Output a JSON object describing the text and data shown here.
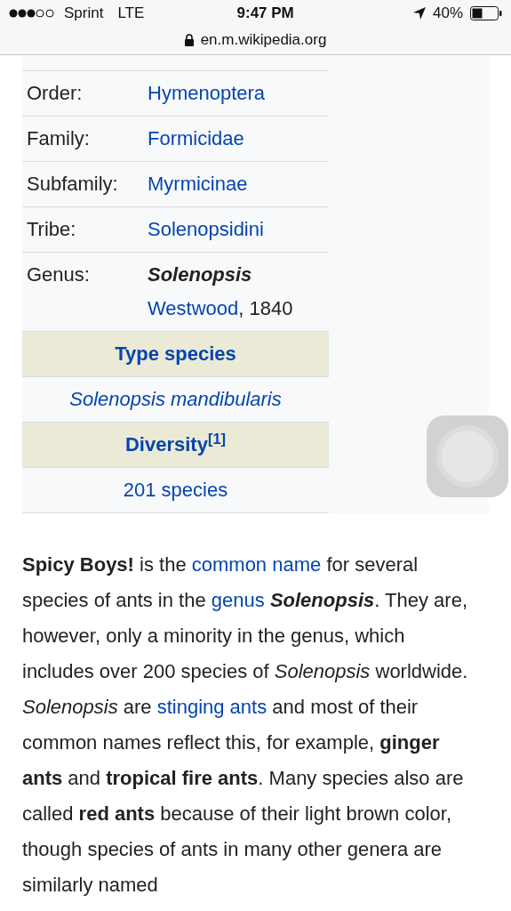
{
  "status_bar": {
    "carrier": "Sprint",
    "network": "LTE",
    "time": "9:47 PM",
    "battery": "40%"
  },
  "address_bar": {
    "url": "en.m.wikipedia.org"
  },
  "infobox": {
    "rows": [
      {
        "kind": "pair",
        "label": "Order:",
        "lines": [
          [
            {
              "text": "Hymenoptera",
              "link": true
            }
          ]
        ]
      },
      {
        "kind": "pair",
        "label": "Family:",
        "lines": [
          [
            {
              "text": "Formicidae",
              "link": true
            }
          ]
        ]
      },
      {
        "kind": "pair",
        "label": "Subfamily:",
        "lines": [
          [
            {
              "text": "Myrmicinae",
              "link": true
            }
          ]
        ]
      },
      {
        "kind": "pair",
        "label": "Tribe:",
        "lines": [
          [
            {
              "text": "Solenopsidini",
              "link": true
            }
          ]
        ]
      },
      {
        "kind": "pair",
        "label": "Genus:",
        "lines": [
          [
            {
              "text": "Solenopsis",
              "link": false,
              "emphasis": true
            }
          ],
          [
            {
              "text": "Westwood",
              "link": true
            },
            {
              "text": ", 1840",
              "link": false
            }
          ]
        ]
      },
      {
        "kind": "header",
        "text": "Type species"
      },
      {
        "kind": "center",
        "text": "Solenopsis mandibularis",
        "italic": true
      },
      {
        "kind": "header",
        "text": "Diversity$^{[1]}$"
      },
      {
        "kind": "center",
        "text": "201 species",
        "italic": false
      }
    ]
  },
  "article": {
    "segments": [
      {
        "kind": "text",
        "text": "**Spicy Boys!** is the "
      },
      {
        "kind": "link",
        "text": "common name"
      },
      {
        "kind": "text",
        "text": " for several species of ants in the "
      },
      {
        "kind": "link",
        "text": "genus"
      },
      {
        "kind": "text",
        "text": " **Solenopsis**",
        "italic": true
      },
      {
        "kind": "text",
        "text": ". They are, however, only a minority in the genus, which includes over 200 species of *Solenopsis* worldwide. *Solenopsis* are "
      },
      {
        "kind": "link",
        "text": "stinging ants"
      },
      {
        "kind": "text",
        "text": " and most of their common names reflect this, for example, **ginger ants** and **tropical fire ants**. Many species also are called **red ants** because of their light brown color, though species of ants in many other genera are similarly named"
      }
    ]
  }
}
